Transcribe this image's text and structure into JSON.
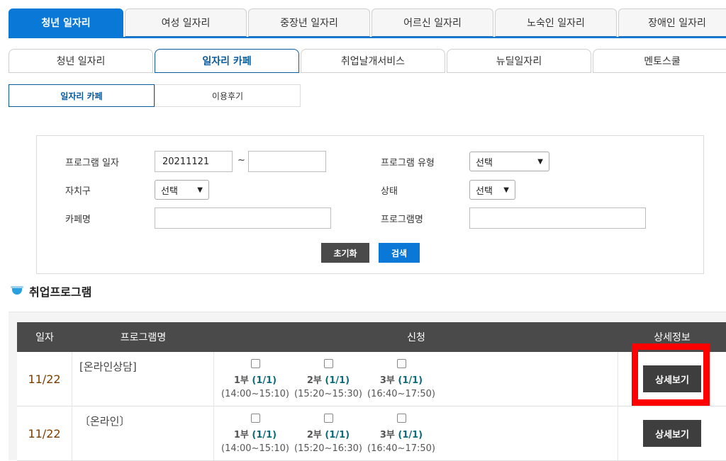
{
  "tabs_level1": [
    {
      "label": "청년 일자리",
      "active": true
    },
    {
      "label": "여성 일자리",
      "active": false
    },
    {
      "label": "중장년 일자리",
      "active": false
    },
    {
      "label": "어르신 일자리",
      "active": false
    },
    {
      "label": "노숙인 일자리",
      "active": false
    },
    {
      "label": "장애인 일자리",
      "active": false
    }
  ],
  "tabs_level2": [
    {
      "label": "청년 일자리",
      "active": false
    },
    {
      "label": "일자리 카페",
      "active": true
    },
    {
      "label": "취업날개서비스",
      "active": false
    },
    {
      "label": "뉴딜일자리",
      "active": false
    },
    {
      "label": "멘토스쿨",
      "active": false
    }
  ],
  "tabs_level3": [
    {
      "label": "일자리 카페",
      "active": true
    },
    {
      "label": "이용후기",
      "active": false
    }
  ],
  "search": {
    "program_date_label": "프로그램 일자",
    "date_from": "20211121",
    "date_to": "",
    "tilde": "~",
    "program_type_label": "프로그램 유형",
    "program_type_value": "선택",
    "district_label": "자치구",
    "district_value": "선택",
    "status_label": "상태",
    "status_value": "선택",
    "cafe_name_label": "카페명",
    "cafe_name_value": "",
    "program_name_label": "프로그램명",
    "program_name_value": "",
    "reset_label": "초기화",
    "search_label": "검색"
  },
  "section": {
    "title": "취업프로그램"
  },
  "table": {
    "headers": {
      "date": "일자",
      "name": "프로그램명",
      "apply": "신청",
      "detail": "상세정보"
    },
    "rows": [
      {
        "date": "11/22",
        "name": "[온라인상담]",
        "slots": [
          {
            "part": "1부",
            "count": "(1/1)",
            "time": "(14:00~15:10)"
          },
          {
            "part": "2부",
            "count": "(1/1)",
            "time": "(15:20~15:30)"
          },
          {
            "part": "3부",
            "count": "(1/1)",
            "time": "(16:40~17:50)"
          }
        ],
        "detail_label": "상세보기"
      },
      {
        "date": "11/22",
        "name": "〔온라인〕",
        "slots": [
          {
            "part": "1부",
            "count": "(1/1)",
            "time": "(14:00~15:10)"
          },
          {
            "part": "2부",
            "count": "(1/1)",
            "time": "(15:20~16:30)"
          },
          {
            "part": "3부",
            "count": "(1/1)",
            "time": "(16:40~17:50)"
          }
        ],
        "detail_label": "상세보기"
      }
    ]
  },
  "colors": {
    "primary": "#0a78d6",
    "dark": "#4a4a4a",
    "highlight": "#ff0000",
    "date": "#7a3d00"
  }
}
